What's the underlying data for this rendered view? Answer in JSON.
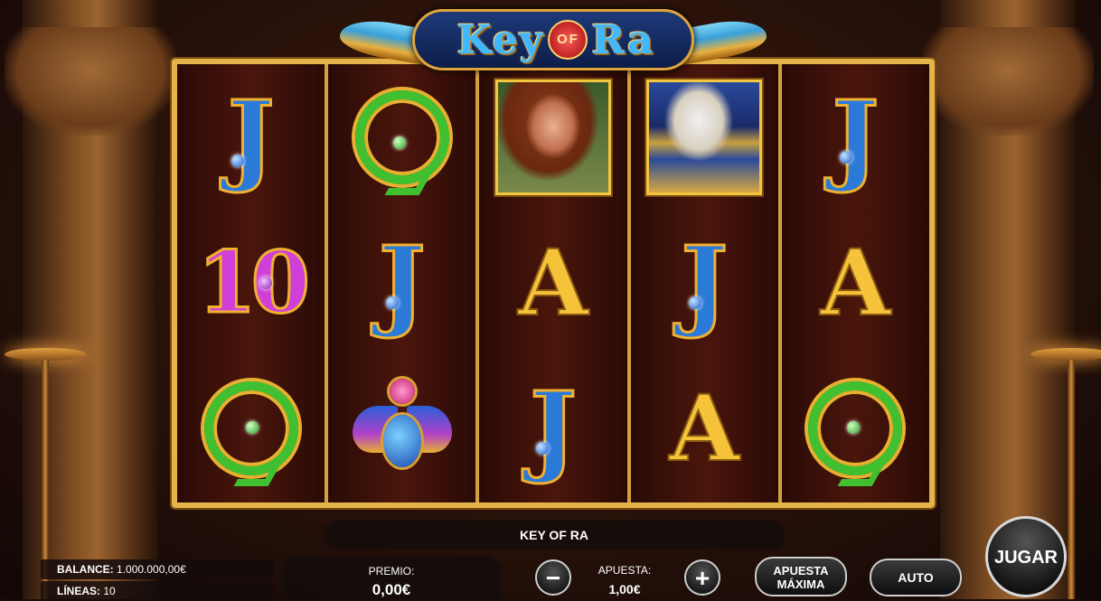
{
  "game": {
    "logo": {
      "left": "Key",
      "of": "OF",
      "right": "Ra"
    },
    "title_bar": "KEY OF RA"
  },
  "reels": [
    [
      "J",
      "10",
      "Q"
    ],
    [
      "Q",
      "J",
      "scarab"
    ],
    [
      "woman-portrait",
      "A",
      "J"
    ],
    [
      "falcon-portrait",
      "J",
      "A"
    ],
    [
      "J",
      "A",
      "Q"
    ]
  ],
  "hud": {
    "balance_label": "BALANCE:",
    "balance_value": "1.000.000,00€",
    "lines_label": "LÍNEAS:",
    "lines_value": "10",
    "premio_label": "PREMIO:",
    "premio_value": "0,00€",
    "apuesta_label": "APUESTA:",
    "apuesta_value": "1,00€",
    "minus": "−",
    "plus": "+",
    "max_bet_line1": "APUESTA",
    "max_bet_line2": "MÁXIMA",
    "auto": "AUTO",
    "play": "JUGAR"
  },
  "colors": {
    "frame_gold": "#e4b44a",
    "reel_bg": "#3a1208",
    "logo_blue": "#3fb8ff"
  }
}
